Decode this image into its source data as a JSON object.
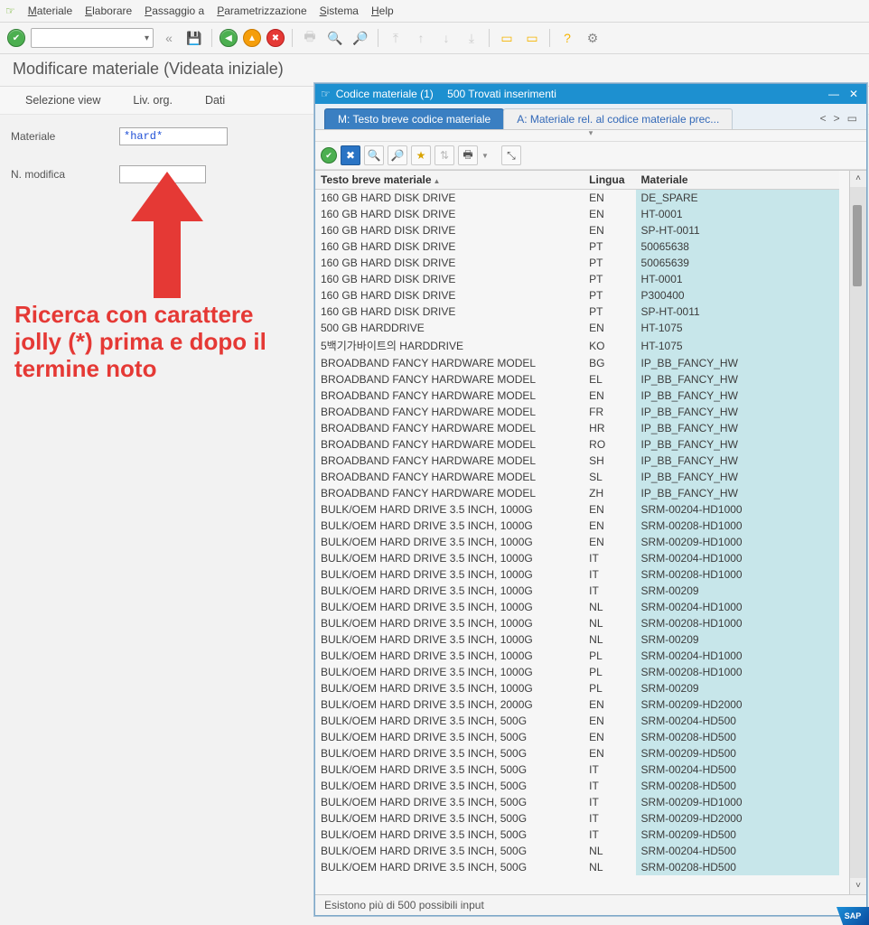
{
  "menu": {
    "items": [
      "Materiale",
      "Elaborare",
      "Passaggio a",
      "Parametrizzazione",
      "Sistema",
      "Help"
    ],
    "underlines": [
      "M",
      "E",
      "P",
      "P",
      "S",
      "H"
    ]
  },
  "page_title": "Modificare materiale (Videata iniziale)",
  "subbar": [
    "Selezione view",
    "Liv. org.",
    "Dati"
  ],
  "form": {
    "materiale_label": "Materiale",
    "materiale_value": "*hard*",
    "nmod_label": "N. modifica",
    "nmod_value": ""
  },
  "annotation": "Ricerca con carattere jolly (*) prima e dopo il termine noto",
  "popup": {
    "title_prefix": "Codice materiale (1)",
    "title_count": "500 Trovati inserimenti",
    "tabs": [
      {
        "label": "M: Testo breve codice materiale",
        "active": true
      },
      {
        "label": "A: Materiale rel. al codice materiale prec...",
        "active": false
      }
    ],
    "columns": [
      "Testo breve materiale",
      "Lingua",
      "Materiale"
    ],
    "rows": [
      [
        "160 GB HARD DISK DRIVE",
        "EN",
        "DE_SPARE"
      ],
      [
        "160 GB HARD DISK DRIVE",
        "EN",
        "HT-0001"
      ],
      [
        "160 GB HARD DISK DRIVE",
        "EN",
        "SP-HT-0011"
      ],
      [
        "160 GB HARD DISK DRIVE",
        "PT",
        "50065638"
      ],
      [
        "160 GB HARD DISK DRIVE",
        "PT",
        "50065639"
      ],
      [
        "160 GB HARD DISK DRIVE",
        "PT",
        "HT-0001"
      ],
      [
        "160 GB HARD DISK DRIVE",
        "PT",
        "P300400"
      ],
      [
        "160 GB HARD DISK DRIVE",
        "PT",
        "SP-HT-0011"
      ],
      [
        "500 GB HARDDRIVE",
        "EN",
        "HT-1075"
      ],
      [
        "5백기가바이트의 HARDDRIVE",
        "KO",
        "HT-1075"
      ],
      [
        "BROADBAND FANCY HARDWARE MODEL",
        "BG",
        "IP_BB_FANCY_HW"
      ],
      [
        "BROADBAND FANCY HARDWARE MODEL",
        "EL",
        "IP_BB_FANCY_HW"
      ],
      [
        "BROADBAND FANCY HARDWARE MODEL",
        "EN",
        "IP_BB_FANCY_HW"
      ],
      [
        "BROADBAND FANCY HARDWARE MODEL",
        "FR",
        "IP_BB_FANCY_HW"
      ],
      [
        "BROADBAND FANCY HARDWARE MODEL",
        "HR",
        "IP_BB_FANCY_HW"
      ],
      [
        "BROADBAND FANCY HARDWARE MODEL",
        "RO",
        "IP_BB_FANCY_HW"
      ],
      [
        "BROADBAND FANCY HARDWARE MODEL",
        "SH",
        "IP_BB_FANCY_HW"
      ],
      [
        "BROADBAND FANCY HARDWARE MODEL",
        "SL",
        "IP_BB_FANCY_HW"
      ],
      [
        "BROADBAND FANCY HARDWARE MODEL",
        "ZH",
        "IP_BB_FANCY_HW"
      ],
      [
        "BULK/OEM HARD DRIVE 3.5 INCH, 1000G",
        "EN",
        "SRM-00204-HD1000"
      ],
      [
        "BULK/OEM HARD DRIVE 3.5 INCH, 1000G",
        "EN",
        "SRM-00208-HD1000"
      ],
      [
        "BULK/OEM HARD DRIVE 3.5 INCH, 1000G",
        "EN",
        "SRM-00209-HD1000"
      ],
      [
        "BULK/OEM HARD DRIVE 3.5 INCH, 1000G",
        "IT",
        "SRM-00204-HD1000"
      ],
      [
        "BULK/OEM HARD DRIVE 3.5 INCH, 1000G",
        "IT",
        "SRM-00208-HD1000"
      ],
      [
        "BULK/OEM HARD DRIVE 3.5 INCH, 1000G",
        "IT",
        "SRM-00209"
      ],
      [
        "BULK/OEM HARD DRIVE 3.5 INCH, 1000G",
        "NL",
        "SRM-00204-HD1000"
      ],
      [
        "BULK/OEM HARD DRIVE 3.5 INCH, 1000G",
        "NL",
        "SRM-00208-HD1000"
      ],
      [
        "BULK/OEM HARD DRIVE 3.5 INCH, 1000G",
        "NL",
        "SRM-00209"
      ],
      [
        "BULK/OEM HARD DRIVE 3.5 INCH, 1000G",
        "PL",
        "SRM-00204-HD1000"
      ],
      [
        "BULK/OEM HARD DRIVE 3.5 INCH, 1000G",
        "PL",
        "SRM-00208-HD1000"
      ],
      [
        "BULK/OEM HARD DRIVE 3.5 INCH, 1000G",
        "PL",
        "SRM-00209"
      ],
      [
        "BULK/OEM HARD DRIVE 3.5 INCH, 2000G",
        "EN",
        "SRM-00209-HD2000"
      ],
      [
        "BULK/OEM HARD DRIVE 3.5 INCH, 500G",
        "EN",
        "SRM-00204-HD500"
      ],
      [
        "BULK/OEM HARD DRIVE 3.5 INCH, 500G",
        "EN",
        "SRM-00208-HD500"
      ],
      [
        "BULK/OEM HARD DRIVE 3.5 INCH, 500G",
        "EN",
        "SRM-00209-HD500"
      ],
      [
        "BULK/OEM HARD DRIVE 3.5 INCH, 500G",
        "IT",
        "SRM-00204-HD500"
      ],
      [
        "BULK/OEM HARD DRIVE 3.5 INCH, 500G",
        "IT",
        "SRM-00208-HD500"
      ],
      [
        "BULK/OEM HARD DRIVE 3.5 INCH, 500G",
        "IT",
        "SRM-00209-HD1000"
      ],
      [
        "BULK/OEM HARD DRIVE 3.5 INCH, 500G",
        "IT",
        "SRM-00209-HD2000"
      ],
      [
        "BULK/OEM HARD DRIVE 3.5 INCH, 500G",
        "IT",
        "SRM-00209-HD500"
      ],
      [
        "BULK/OEM HARD DRIVE 3.5 INCH, 500G",
        "NL",
        "SRM-00204-HD500"
      ],
      [
        "BULK/OEM HARD DRIVE 3.5 INCH, 500G",
        "NL",
        "SRM-00208-HD500"
      ]
    ],
    "status": "Esistono più di  500 possibili input"
  },
  "sap_logo": "SAP"
}
